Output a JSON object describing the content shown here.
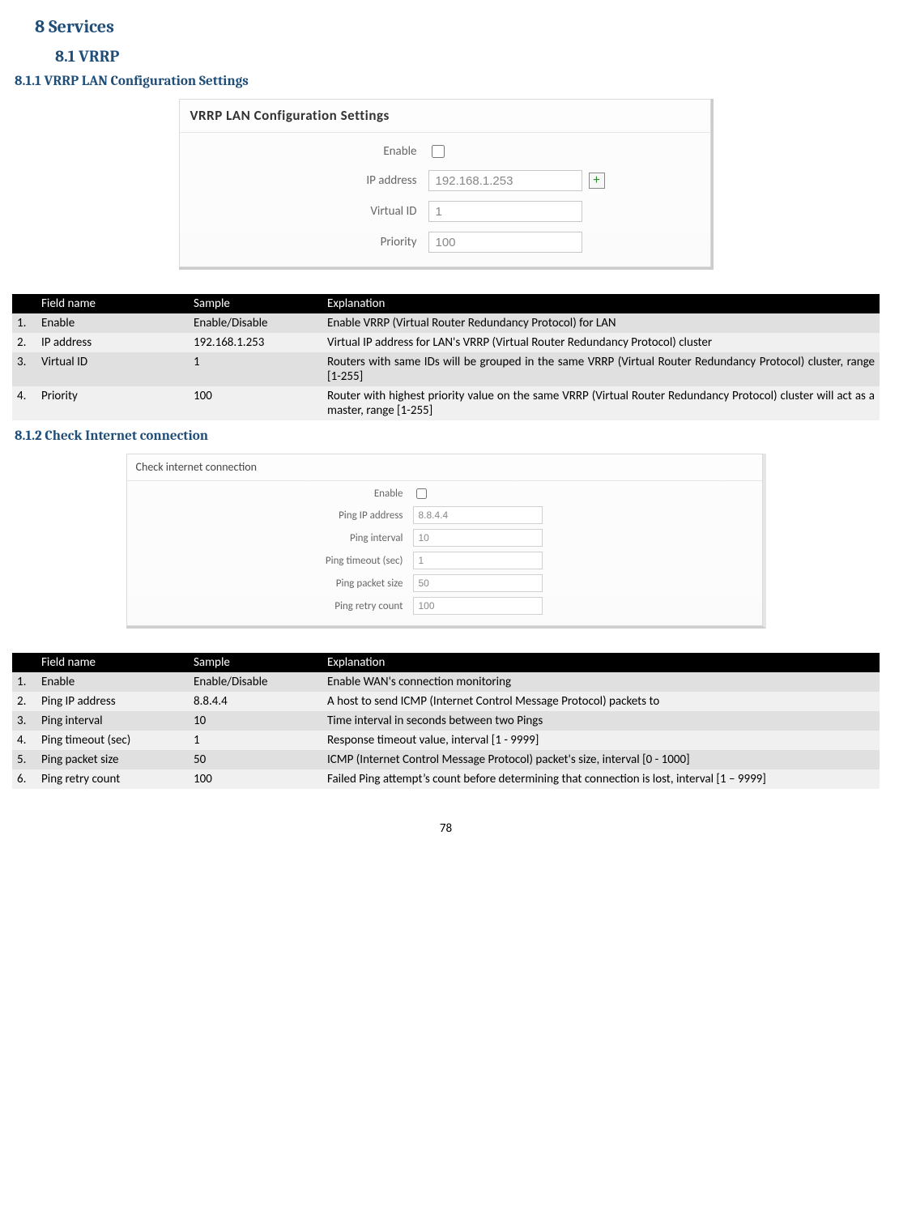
{
  "page_number": "78",
  "h1": "8    Services",
  "h2_1": "8.1    VRRP",
  "h3_1": "8.1.1  VRRP LAN Configuration Settings",
  "h3_2": "8.1.2  Check Internet connection",
  "panel1": {
    "title": "VRRP LAN Configuration Settings",
    "enable_label": "Enable",
    "ip_label": "IP address",
    "ip_value": "192.168.1.253",
    "vid_label": "Virtual ID",
    "vid_value": "1",
    "prio_label": "Priority",
    "prio_value": "100",
    "add_glyph": "+"
  },
  "panel2": {
    "title": "Check internet connection",
    "enable_label": "Enable",
    "ip_label": "Ping IP address",
    "ip_value": "8.8.4.4",
    "interval_label": "Ping interval",
    "interval_value": "10",
    "timeout_label": "Ping timeout (sec)",
    "timeout_value": "1",
    "size_label": "Ping packet size",
    "size_value": "50",
    "retry_label": "Ping retry count",
    "retry_value": "100"
  },
  "table_headers": {
    "num": "",
    "name": "Field name",
    "value": "Sample",
    "expl": "Explanation"
  },
  "table1": {
    "rows": [
      {
        "n": "1.",
        "name": "Enable",
        "val": "Enable/Disable",
        "exp": "Enable VRRP (Virtual Router Redundancy Protocol) for LAN"
      },
      {
        "n": "2.",
        "name": "IP address",
        "val": "192.168.1.253",
        "exp": "Virtual IP address for LAN's VRRP (Virtual Router Redundancy Protocol) cluster"
      },
      {
        "n": "3.",
        "name": "Virtual ID",
        "val": "1",
        "exp": "Routers with same IDs will be grouped in the same VRRP (Virtual Router Redundancy Protocol) cluster, range [1-255]"
      },
      {
        "n": "4.",
        "name": "Priority",
        "val": "100",
        "exp": "Router with highest priority value on the same VRRP (Virtual Router Redundancy Protocol) cluster will act as a master, range [1-255]"
      }
    ]
  },
  "table2": {
    "rows": [
      {
        "n": "1.",
        "name": "Enable",
        "val": "Enable/Disable",
        "exp": "Enable WAN's connection monitoring"
      },
      {
        "n": "2.",
        "name": "Ping IP address",
        "val": "8.8.4.4",
        "exp": "A host to send ICMP (Internet Control Message Protocol) packets to"
      },
      {
        "n": "3.",
        "name": "Ping interval",
        "val": "10",
        "exp": "Time interval in seconds between two Pings"
      },
      {
        "n": "4.",
        "name": "Ping timeout (sec)",
        "val": "1",
        "exp": "Response timeout value, interval [1 - 9999]"
      },
      {
        "n": "5.",
        "name": "Ping packet size",
        "val": "50",
        "exp": "ICMP (Internet Control Message Protocol) packet's size, interval [0 - 1000]"
      },
      {
        "n": "6.",
        "name": "Ping retry count",
        "val": "100",
        "exp": "Failed Ping attempt’s count before determining that connection is lost, interval [1 – 9999]"
      }
    ]
  }
}
